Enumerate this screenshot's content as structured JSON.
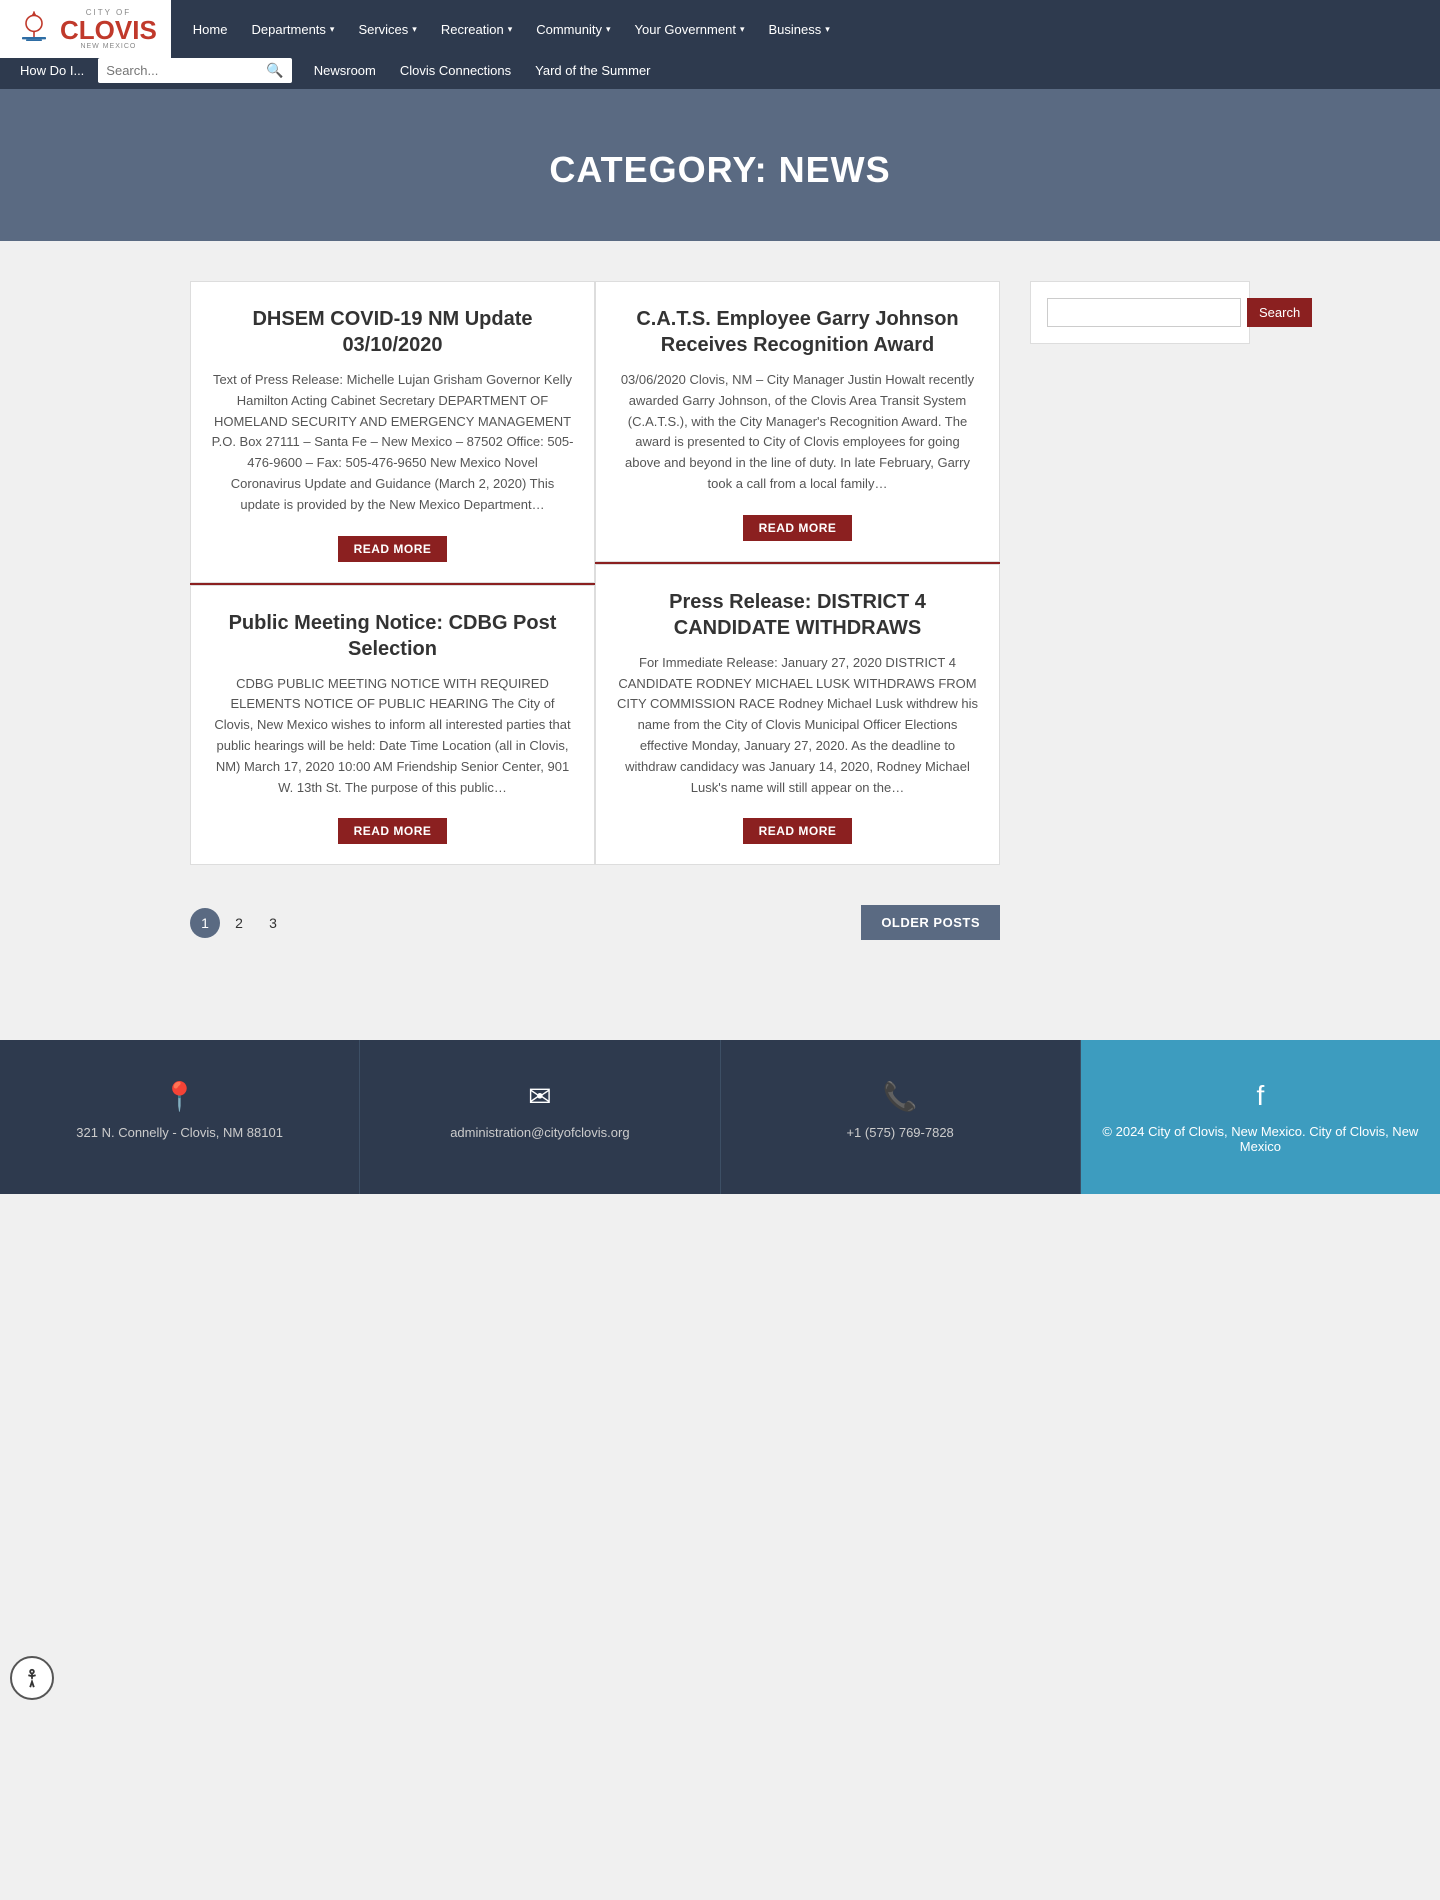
{
  "nav": {
    "logo": {
      "city": "CITY OF",
      "name": "CLOVIS",
      "state": "NEW MEXICO"
    },
    "top_items": [
      {
        "label": "Home",
        "has_arrow": false
      },
      {
        "label": "Departments",
        "has_arrow": true
      },
      {
        "label": "Services",
        "has_arrow": true
      },
      {
        "label": "Recreation",
        "has_arrow": true
      },
      {
        "label": "Community",
        "has_arrow": true
      },
      {
        "label": "Your Government",
        "has_arrow": true
      },
      {
        "label": "Business",
        "has_arrow": true
      }
    ],
    "bottom_items": [
      {
        "label": "How Do I..."
      },
      {
        "label": "Newsroom"
      },
      {
        "label": "Clovis Connections"
      },
      {
        "label": "Yard of the Summer"
      }
    ],
    "search_placeholder": "Search..."
  },
  "page_header": {
    "title": "CATEGORY: NEWS"
  },
  "posts": [
    {
      "id": "post-1",
      "title": "DHSEM COVID-19 NM Update 03/10/2020",
      "excerpt": "Text of Press Release: Michelle Lujan Grisham Governor Kelly Hamilton Acting Cabinet Secretary DEPARTMENT OF HOMELAND SECURITY AND EMERGENCY MANAGEMENT P.O. Box 27111 – Santa Fe – New Mexico – 87502 Office: 505-476-9600 – Fax: 505-476-9650 New Mexico Novel Coronavirus Update and Guidance (March 2, 2020) This update is provided by the New Mexico Department…",
      "read_more": "READ MORE",
      "col": "left",
      "order": 1
    },
    {
      "id": "post-2",
      "title": "Public Meeting Notice: CDBG Post Selection",
      "excerpt": "CDBG PUBLIC MEETING NOTICE WITH REQUIRED ELEMENTS NOTICE OF PUBLIC HEARING The City of Clovis, New Mexico wishes to inform all interested parties that public hearings will be held:\nDate                                          Time\nLocation  (all in Clovis, NM)  March 17, 2020  10:00 AM                             Friendship Senior Center, 901 W. 13th St. The purpose of this public…",
      "read_more": "READ MORE",
      "col": "left",
      "order": 2
    },
    {
      "id": "post-3",
      "title": "C.A.T.S. Employee Garry Johnson Receives Recognition Award",
      "excerpt": "03/06/2020 Clovis, NM – City Manager Justin Howalt recently awarded Garry Johnson, of the Clovis Area Transit System (C.A.T.S.), with the City Manager's Recognition Award. The award is presented to City of Clovis employees for going above and beyond in the line of duty. In late February, Garry took a call from a local family…",
      "read_more": "READ MORE",
      "col": "right",
      "order": 1
    },
    {
      "id": "post-4",
      "title": "Press Release: DISTRICT 4 CANDIDATE WITHDRAWS",
      "excerpt": "For Immediate Release: January 27, 2020 DISTRICT 4 CANDIDATE RODNEY MICHAEL LUSK WITHDRAWS FROM CITY COMMISSION RACE Rodney Michael Lusk withdrew his name from the City of Clovis Municipal Officer Elections effective Monday, January 27, 2020. As the deadline to withdraw candidacy was January 14, 2020, Rodney Michael Lusk's name will still appear on the…",
      "read_more": "READ MORE",
      "col": "right",
      "order": 2
    }
  ],
  "sidebar": {
    "search_button": "Search",
    "search_placeholder": ""
  },
  "pagination": {
    "pages": [
      "1",
      "2",
      "3"
    ],
    "current": "1",
    "older_posts": "OLDER POSTS"
  },
  "footer": {
    "address": "321 N. Connelly - Clovis, NM 88101",
    "email": "administration@cityofclovis.org",
    "phone": "+1 (575) 769-7828",
    "copyright": "© 2024 City of Clovis, New Mexico. City of Clovis, New Mexico"
  }
}
